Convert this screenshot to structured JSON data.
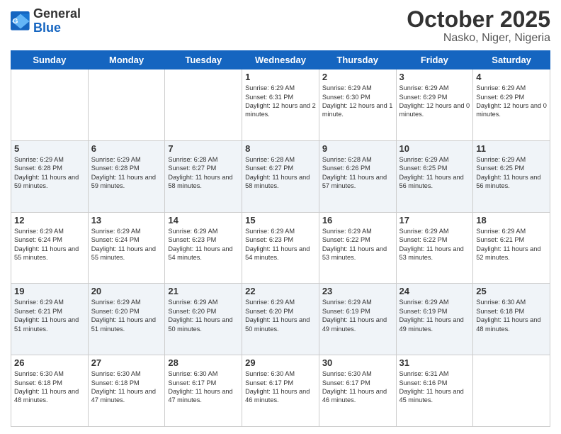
{
  "header": {
    "logo_general": "General",
    "logo_blue": "Blue",
    "month_title": "October 2025",
    "location": "Nasko, Niger, Nigeria"
  },
  "days_of_week": [
    "Sunday",
    "Monday",
    "Tuesday",
    "Wednesday",
    "Thursday",
    "Friday",
    "Saturday"
  ],
  "weeks": [
    [
      {
        "day": "",
        "info": ""
      },
      {
        "day": "",
        "info": ""
      },
      {
        "day": "",
        "info": ""
      },
      {
        "day": "1",
        "info": "Sunrise: 6:29 AM\nSunset: 6:31 PM\nDaylight: 12 hours\nand 2 minutes."
      },
      {
        "day": "2",
        "info": "Sunrise: 6:29 AM\nSunset: 6:30 PM\nDaylight: 12 hours\nand 1 minute."
      },
      {
        "day": "3",
        "info": "Sunrise: 6:29 AM\nSunset: 6:29 PM\nDaylight: 12 hours\nand 0 minutes."
      },
      {
        "day": "4",
        "info": "Sunrise: 6:29 AM\nSunset: 6:29 PM\nDaylight: 12 hours\nand 0 minutes."
      }
    ],
    [
      {
        "day": "5",
        "info": "Sunrise: 6:29 AM\nSunset: 6:28 PM\nDaylight: 11 hours\nand 59 minutes."
      },
      {
        "day": "6",
        "info": "Sunrise: 6:29 AM\nSunset: 6:28 PM\nDaylight: 11 hours\nand 59 minutes."
      },
      {
        "day": "7",
        "info": "Sunrise: 6:28 AM\nSunset: 6:27 PM\nDaylight: 11 hours\nand 58 minutes."
      },
      {
        "day": "8",
        "info": "Sunrise: 6:28 AM\nSunset: 6:27 PM\nDaylight: 11 hours\nand 58 minutes."
      },
      {
        "day": "9",
        "info": "Sunrise: 6:28 AM\nSunset: 6:26 PM\nDaylight: 11 hours\nand 57 minutes."
      },
      {
        "day": "10",
        "info": "Sunrise: 6:29 AM\nSunset: 6:25 PM\nDaylight: 11 hours\nand 56 minutes."
      },
      {
        "day": "11",
        "info": "Sunrise: 6:29 AM\nSunset: 6:25 PM\nDaylight: 11 hours\nand 56 minutes."
      }
    ],
    [
      {
        "day": "12",
        "info": "Sunrise: 6:29 AM\nSunset: 6:24 PM\nDaylight: 11 hours\nand 55 minutes."
      },
      {
        "day": "13",
        "info": "Sunrise: 6:29 AM\nSunset: 6:24 PM\nDaylight: 11 hours\nand 55 minutes."
      },
      {
        "day": "14",
        "info": "Sunrise: 6:29 AM\nSunset: 6:23 PM\nDaylight: 11 hours\nand 54 minutes."
      },
      {
        "day": "15",
        "info": "Sunrise: 6:29 AM\nSunset: 6:23 PM\nDaylight: 11 hours\nand 54 minutes."
      },
      {
        "day": "16",
        "info": "Sunrise: 6:29 AM\nSunset: 6:22 PM\nDaylight: 11 hours\nand 53 minutes."
      },
      {
        "day": "17",
        "info": "Sunrise: 6:29 AM\nSunset: 6:22 PM\nDaylight: 11 hours\nand 53 minutes."
      },
      {
        "day": "18",
        "info": "Sunrise: 6:29 AM\nSunset: 6:21 PM\nDaylight: 11 hours\nand 52 minutes."
      }
    ],
    [
      {
        "day": "19",
        "info": "Sunrise: 6:29 AM\nSunset: 6:21 PM\nDaylight: 11 hours\nand 51 minutes."
      },
      {
        "day": "20",
        "info": "Sunrise: 6:29 AM\nSunset: 6:20 PM\nDaylight: 11 hours\nand 51 minutes."
      },
      {
        "day": "21",
        "info": "Sunrise: 6:29 AM\nSunset: 6:20 PM\nDaylight: 11 hours\nand 50 minutes."
      },
      {
        "day": "22",
        "info": "Sunrise: 6:29 AM\nSunset: 6:20 PM\nDaylight: 11 hours\nand 50 minutes."
      },
      {
        "day": "23",
        "info": "Sunrise: 6:29 AM\nSunset: 6:19 PM\nDaylight: 11 hours\nand 49 minutes."
      },
      {
        "day": "24",
        "info": "Sunrise: 6:29 AM\nSunset: 6:19 PM\nDaylight: 11 hours\nand 49 minutes."
      },
      {
        "day": "25",
        "info": "Sunrise: 6:30 AM\nSunset: 6:18 PM\nDaylight: 11 hours\nand 48 minutes."
      }
    ],
    [
      {
        "day": "26",
        "info": "Sunrise: 6:30 AM\nSunset: 6:18 PM\nDaylight: 11 hours\nand 48 minutes."
      },
      {
        "day": "27",
        "info": "Sunrise: 6:30 AM\nSunset: 6:18 PM\nDaylight: 11 hours\nand 47 minutes."
      },
      {
        "day": "28",
        "info": "Sunrise: 6:30 AM\nSunset: 6:17 PM\nDaylight: 11 hours\nand 47 minutes."
      },
      {
        "day": "29",
        "info": "Sunrise: 6:30 AM\nSunset: 6:17 PM\nDaylight: 11 hours\nand 46 minutes."
      },
      {
        "day": "30",
        "info": "Sunrise: 6:30 AM\nSunset: 6:17 PM\nDaylight: 11 hours\nand 46 minutes."
      },
      {
        "day": "31",
        "info": "Sunrise: 6:31 AM\nSunset: 6:16 PM\nDaylight: 11 hours\nand 45 minutes."
      },
      {
        "day": "",
        "info": ""
      }
    ]
  ]
}
